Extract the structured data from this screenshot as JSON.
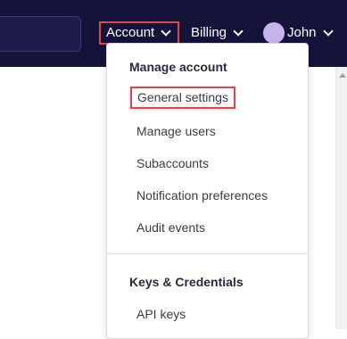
{
  "header": {
    "account_label": "Account",
    "billing_label": "Billing",
    "user_name": "John"
  },
  "dropdown": {
    "sections": [
      {
        "title": "Manage account",
        "items": [
          "General settings",
          "Manage users",
          "Subaccounts",
          "Notification preferences",
          "Audit events"
        ]
      },
      {
        "title": "Keys & Credentials",
        "items": [
          "API keys"
        ]
      }
    ]
  },
  "colors": {
    "topbar": "#15133a",
    "highlight_border": "#e0454b",
    "avatar": "#c8b4ec"
  }
}
